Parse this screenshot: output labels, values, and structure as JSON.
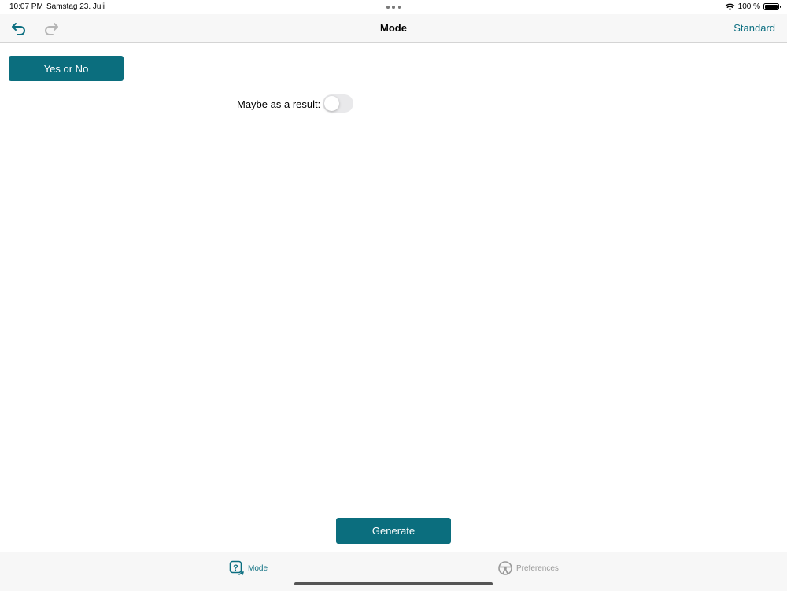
{
  "status_bar": {
    "time": "10:07 PM",
    "date": "Samstag 23. Juli",
    "battery_text": "100 %",
    "battery_level": 1.0
  },
  "nav": {
    "title": "Mode",
    "right_action": "Standard",
    "undo_icon": "undo-arrow-icon",
    "redo_icon": "redo-arrow-icon"
  },
  "content": {
    "mode_button": "Yes or No",
    "maybe_label": "Maybe as a result:",
    "maybe_toggle_on": false,
    "generate_button": "Generate"
  },
  "tabs": [
    {
      "label": "Mode",
      "icon": "question-dice-icon",
      "active": true
    },
    {
      "label": "Preferences",
      "icon": "steering-wheel-icon",
      "active": false
    }
  ],
  "colors": {
    "accent": "#0b6e7e",
    "inactive_tab": "#9a9a9a"
  }
}
